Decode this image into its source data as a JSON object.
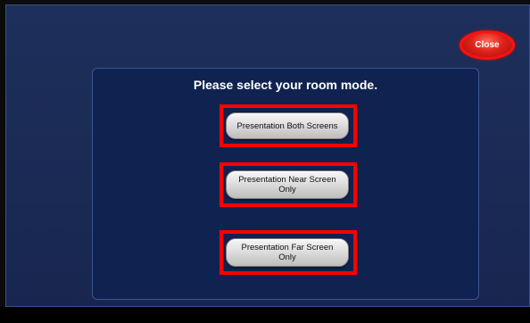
{
  "close_button": {
    "label": "Close"
  },
  "dialog": {
    "prompt": "Please select your room mode.",
    "modes": [
      {
        "label": "Presentation Both Screens"
      },
      {
        "label": "Presentation Near Screen Only"
      },
      {
        "label": "Presentation Far Screen Only"
      }
    ]
  },
  "colors": {
    "background": "#1a2a55",
    "dialog": "#102250",
    "highlight": "#ff0000",
    "close_button": "#e0221a"
  }
}
